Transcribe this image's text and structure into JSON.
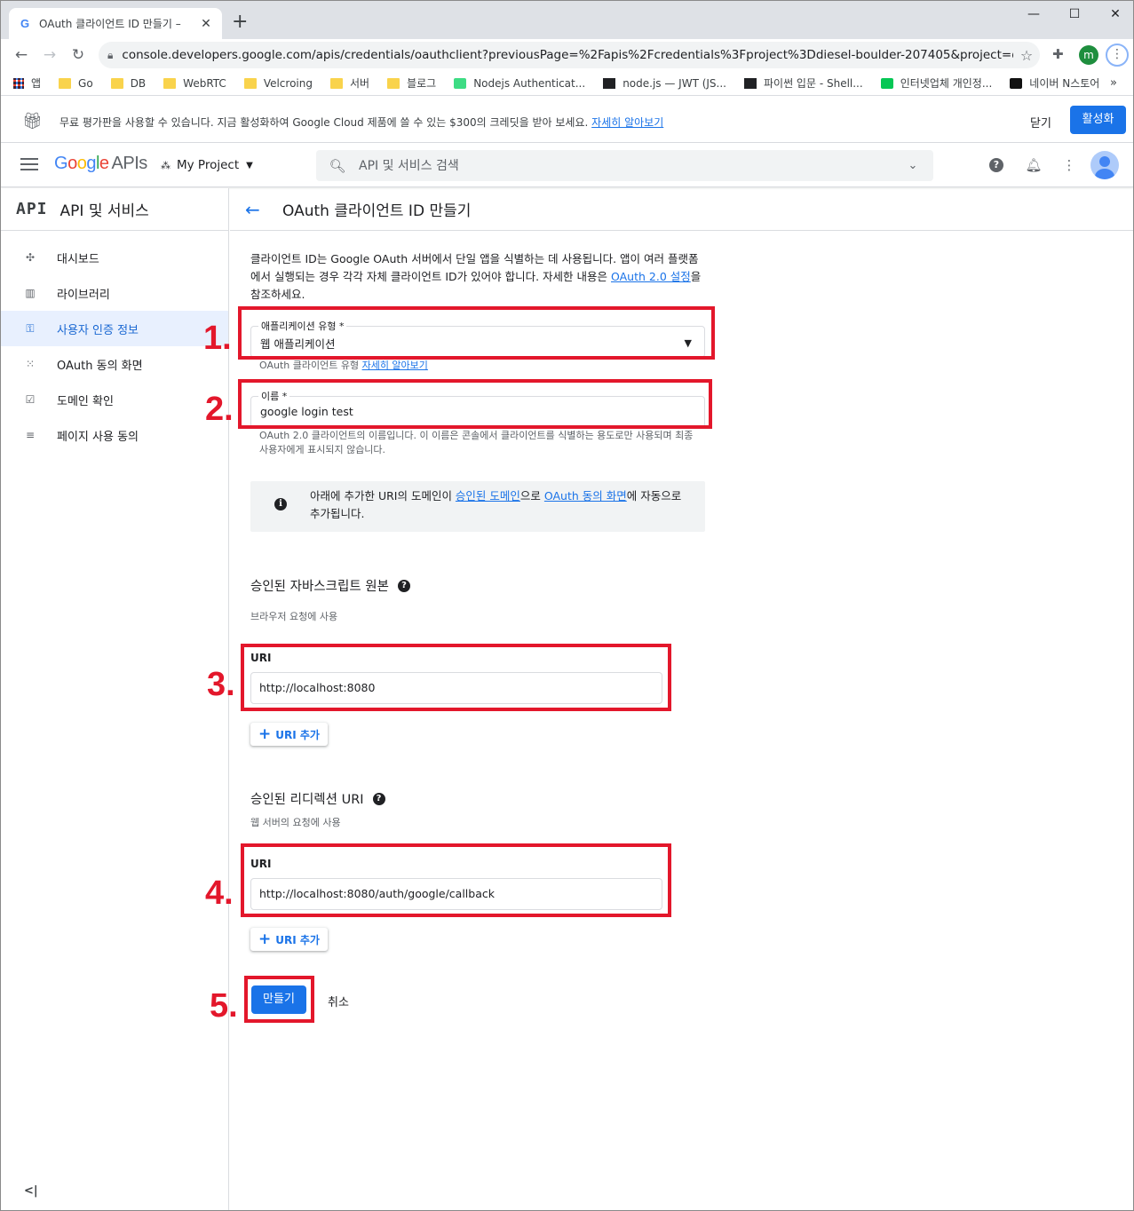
{
  "browser": {
    "tab_title": "OAuth 클라이언트 ID 만들기 – ",
    "tab_favicon": "G",
    "url": "console.developers.google.com/apis/credentials/oauthclient?previousPage=%2Fapis%2Fcredentials%3Fproject%3Ddiesel-boulder-207405&project=diesel-...",
    "profile_initial": "m",
    "bookmarks": [
      {
        "label": "앱",
        "icon": "apps-icon"
      },
      {
        "label": "Go",
        "icon": "folder-icon"
      },
      {
        "label": "DB",
        "icon": "folder-icon"
      },
      {
        "label": "WebRTC",
        "icon": "folder-icon"
      },
      {
        "label": "Velcroing",
        "icon": "folder-icon"
      },
      {
        "label": "서버",
        "icon": "folder-icon"
      },
      {
        "label": "블로그",
        "icon": "folder-icon"
      },
      {
        "label": "Nodejs Authenticat...",
        "icon": "site-icon"
      },
      {
        "label": "node.js — JWT (JS...",
        "icon": "site-icon"
      },
      {
        "label": "파이썬 입문 - Shell...",
        "icon": "site-icon"
      },
      {
        "label": "인터넷업체 개인정...",
        "icon": "site-icon"
      },
      {
        "label": "네이버 N스토어",
        "icon": "site-icon"
      }
    ],
    "bookmarks_more": "»"
  },
  "banner": {
    "message": "무료 평가판을 사용할 수 있습니다. 지금 활성화하여 Google Cloud 제품에 쓸 수 있는 $300의 크레딧을 받아 보세요.",
    "learn_more": "자세히 알아보기",
    "dismiss": "닫기",
    "activate": "활성화"
  },
  "appbar": {
    "logo_apis": "APIs",
    "project": "My Project",
    "search_placeholder": "API 및 서비스 검색"
  },
  "sidenav": {
    "badge": "API",
    "title": "API 및 서비스",
    "items": [
      {
        "label": "대시보드",
        "icon": "dashboard-icon",
        "glyph": "✣"
      },
      {
        "label": "라이브러리",
        "icon": "library-icon",
        "glyph": "▥"
      },
      {
        "label": "사용자 인증 정보",
        "icon": "key-icon",
        "glyph": "⚿"
      },
      {
        "label": "OAuth 동의 화면",
        "icon": "consent-icon",
        "glyph": "⁙"
      },
      {
        "label": "도메인 확인",
        "icon": "checkbox-icon",
        "glyph": "☑"
      },
      {
        "label": "페이지 사용 동의",
        "icon": "settings-list-icon",
        "glyph": "≡"
      }
    ],
    "active_index": 2,
    "collapse": "<|"
  },
  "page": {
    "title": "OAuth 클라이언트 ID 만들기",
    "intro_text": "클라이언트 ID는 Google OAuth 서버에서 단일 앱을 식별하는 데 사용됩니다. 앱이 여러 플랫폼에서 실행되는 경우 각각 자체 클라이언트 ID가 있어야 합니다. 자세한 내용은 ",
    "intro_link": "OAuth 2.0 설정",
    "intro_suffix": "을 참조하세요.",
    "app_type": {
      "label": "애플리케이션 유형 *",
      "value": "웹 애플리케이션",
      "hint_text": "OAuth 클라이언트 유형 ",
      "hint_link": "자세히 알아보기"
    },
    "name": {
      "label": "이름 *",
      "value": "google login test",
      "hint": "OAuth 2.0 클라이언트의 이름입니다. 이 이름은 콘솔에서 클라이언트를 식별하는 용도로만 사용되며 최종 사용자에게 표시되지 않습니다."
    },
    "info": {
      "prefix": "아래에 추가한 URI의 도메인이 ",
      "link1": "승인된 도메인",
      "middle": "으로 ",
      "link2": "OAuth 동의 화면",
      "suffix": "에 자동으로 추가됩니다."
    },
    "js_origins": {
      "title": "승인된 자바스크립트 원본",
      "subtitle": "브라우저 요청에 사용",
      "uri_label": "URI",
      "uri_value": "http://localhost:8080",
      "add_label": "URI 추가"
    },
    "redirect_uris": {
      "title": "승인된 리디렉션 URI",
      "subtitle": "웹 서버의 요청에 사용",
      "uri_label": "URI",
      "uri_value": "http://localhost:8080/auth/google/callback",
      "add_label": "URI 추가"
    },
    "create": "만들기",
    "cancel": "취소"
  },
  "annotations": {
    "color": "#e3172b",
    "steps": [
      "1.",
      "2.",
      "3.",
      "4.",
      "5."
    ]
  }
}
